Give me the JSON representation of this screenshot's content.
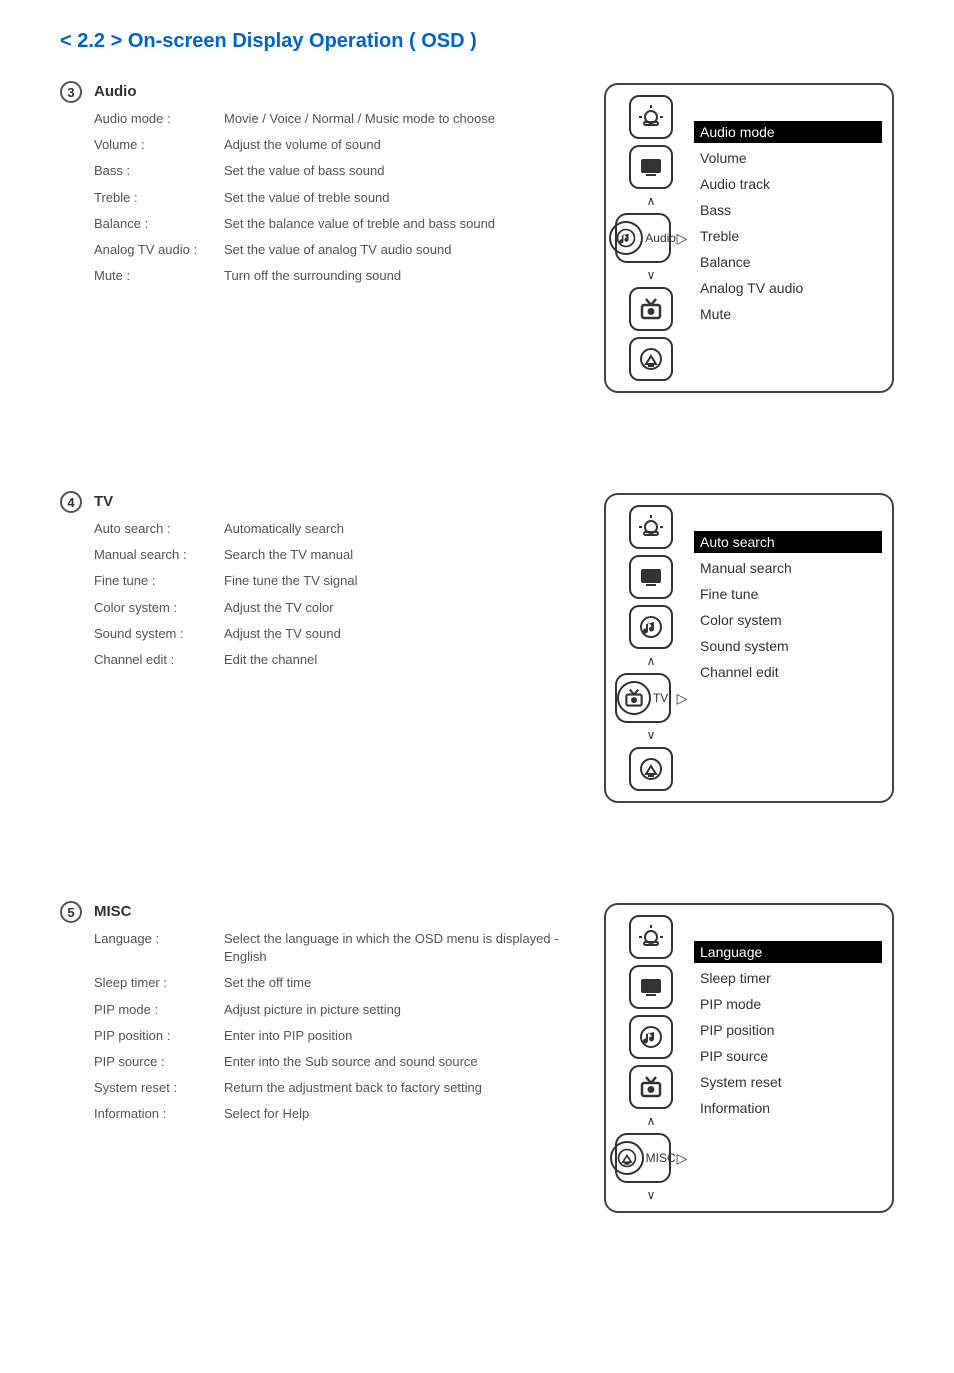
{
  "page_title": "< 2.2 > On-screen Display Operation ( OSD )",
  "sections": [
    {
      "num": "3",
      "title": "Audio",
      "defs": [
        {
          "label": "Audio mode :",
          "desc": "Movie / Voice / Normal / Music mode to choose"
        },
        {
          "label": "Volume :",
          "desc": "Adjust the volume of sound"
        },
        {
          "label": "Bass :",
          "desc": "Set the value of bass sound"
        },
        {
          "label": "Treble :",
          "desc": "Set the value of treble sound"
        },
        {
          "label": "Balance :",
          "desc": "Set the balance value of treble and bass sound"
        },
        {
          "label": "Analog TV audio :",
          "desc": "Set the value of analog TV audio sound"
        },
        {
          "label": "Mute :",
          "desc": "Turn off the surrounding sound"
        }
      ],
      "osd": {
        "active_index": 2,
        "active_label": "Audio",
        "items": [
          "Audio mode",
          "Volume",
          "Audio track",
          "Bass",
          "Treble",
          "Balance",
          "Analog TV audio",
          "Mute"
        ]
      }
    },
    {
      "num": "4",
      "title": "TV",
      "defs": [
        {
          "label": "Auto search :",
          "desc": "Automatically search"
        },
        {
          "label": "Manual search :",
          "desc": "Search the TV manual"
        },
        {
          "label": "Fine tune :",
          "desc": "Fine tune the TV signal"
        },
        {
          "label": "Color system :",
          "desc": "Adjust the TV color"
        },
        {
          "label": "Sound system :",
          "desc": "Adjust the TV sound"
        },
        {
          "label": "Channel edit :",
          "desc": "Edit the channel"
        }
      ],
      "osd": {
        "active_index": 3,
        "active_label": "TV",
        "items": [
          "Auto search",
          "Manual search",
          "Fine tune",
          "Color system",
          "Sound system",
          "Channel edit"
        ]
      }
    },
    {
      "num": "5",
      "title": "MISC",
      "defs": [
        {
          "label": "Language :",
          "desc": "Select the language in which the OSD menu is displayed - English"
        },
        {
          "label": "Sleep timer :",
          "desc": "Set the off time"
        },
        {
          "label": "PIP mode :",
          "desc": "Adjust picture in picture setting"
        },
        {
          "label": "PIP position :",
          "desc": "Enter into PIP position"
        },
        {
          "label": "PIP source :",
          "desc": "Enter into the Sub source and sound source"
        },
        {
          "label": "System reset :",
          "desc": "Return the adjustment back to factory setting"
        },
        {
          "label": "Information :",
          "desc": "Select for Help"
        }
      ],
      "osd": {
        "active_index": 4,
        "active_label": "MISC",
        "items": [
          "Language",
          "Sleep timer",
          "PIP mode",
          "PIP position",
          "PIP source",
          "System reset",
          "Information"
        ]
      }
    }
  ]
}
